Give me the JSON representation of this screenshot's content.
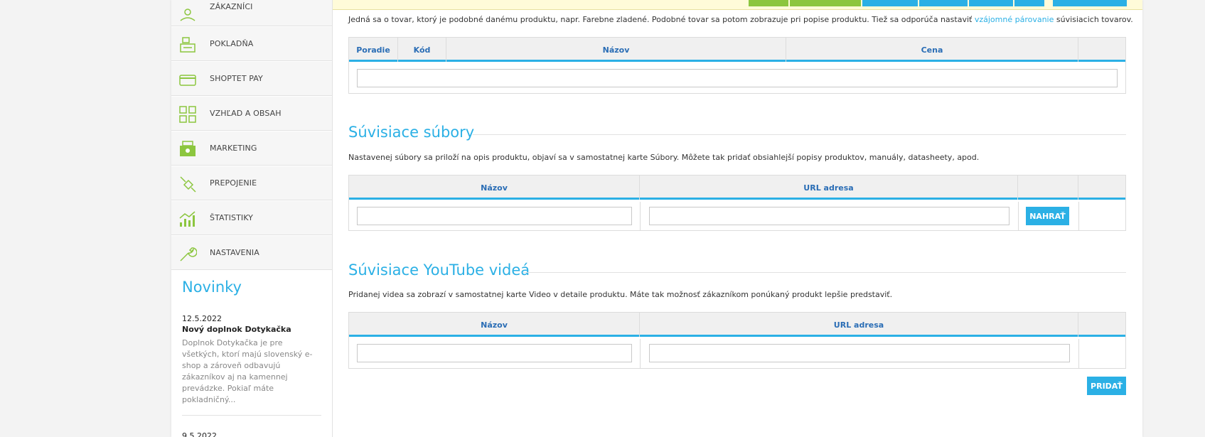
{
  "colors": {
    "accent": "#2bb0e5",
    "header_text": "#2a6db5",
    "green": "#8cc63f",
    "topbar": "#fffbd9"
  },
  "sidebar": {
    "items": [
      {
        "label": "ZÁKAZNÍCI",
        "icon": "customers-icon"
      },
      {
        "label": "POKLADŇA",
        "icon": "cash-register-icon"
      },
      {
        "label": "SHOPTET PAY",
        "icon": "credit-card-icon"
      },
      {
        "label": "VZHĽAD A OBSAH",
        "icon": "layout-grid-icon"
      },
      {
        "label": "MARKETING",
        "icon": "megaphone-icon"
      },
      {
        "label": "PREPOJENIE",
        "icon": "plug-icon"
      },
      {
        "label": "ŠTATISTIKY",
        "icon": "bar-chart-icon"
      },
      {
        "label": "NASTAVENIA",
        "icon": "wrench-icon"
      }
    ]
  },
  "news": {
    "title": "Novinky",
    "items": [
      {
        "date": "12.5.2022",
        "headline": "Nový doplnok Dotykačka",
        "body": "Doplnok Dotykačka je pre všetkých, ktorí majú slovenský e-shop a zároveň odbavujú zákazníkov aj na kamennej prevádzke. Pokiaľ máte pokladničný..."
      },
      {
        "date": "9.5.2022"
      }
    ]
  },
  "similar": {
    "description_before": "Jedná sa o tovar, ktorý je podobné danému produktu, napr. Farebne zladené. Podobné tovar sa potom zobrazuje pri popise produktu. Tiež sa odporúča nastaviť ",
    "link": "vzájomné párovanie",
    "description_after": " súvisiacich tovarov.",
    "columns": [
      "Poradie",
      "Kód",
      "Názov",
      "Cena"
    ]
  },
  "files": {
    "title": "Súvisiace súbory",
    "description": "Nastavenej súbory sa priloží na opis produktu, objaví sa v samostatnej karte Súbory. Môžete tak pridať obsiahlejší popisy produktov, manuály, datasheety, apod.",
    "columns": [
      "Názov",
      "URL adresa"
    ],
    "upload_label": "NAHRAŤ"
  },
  "videos": {
    "title": "Súvisiace YouTube videá",
    "description": "Pridanej videa sa zobrazí v samostatnej karte Video v detaile produktu. Máte tak možnosť zákazníkom ponúkaný produkt lepšie predstaviť.",
    "columns": [
      "Názov",
      "URL adresa"
    ],
    "add_label": "PRIDAŤ"
  }
}
